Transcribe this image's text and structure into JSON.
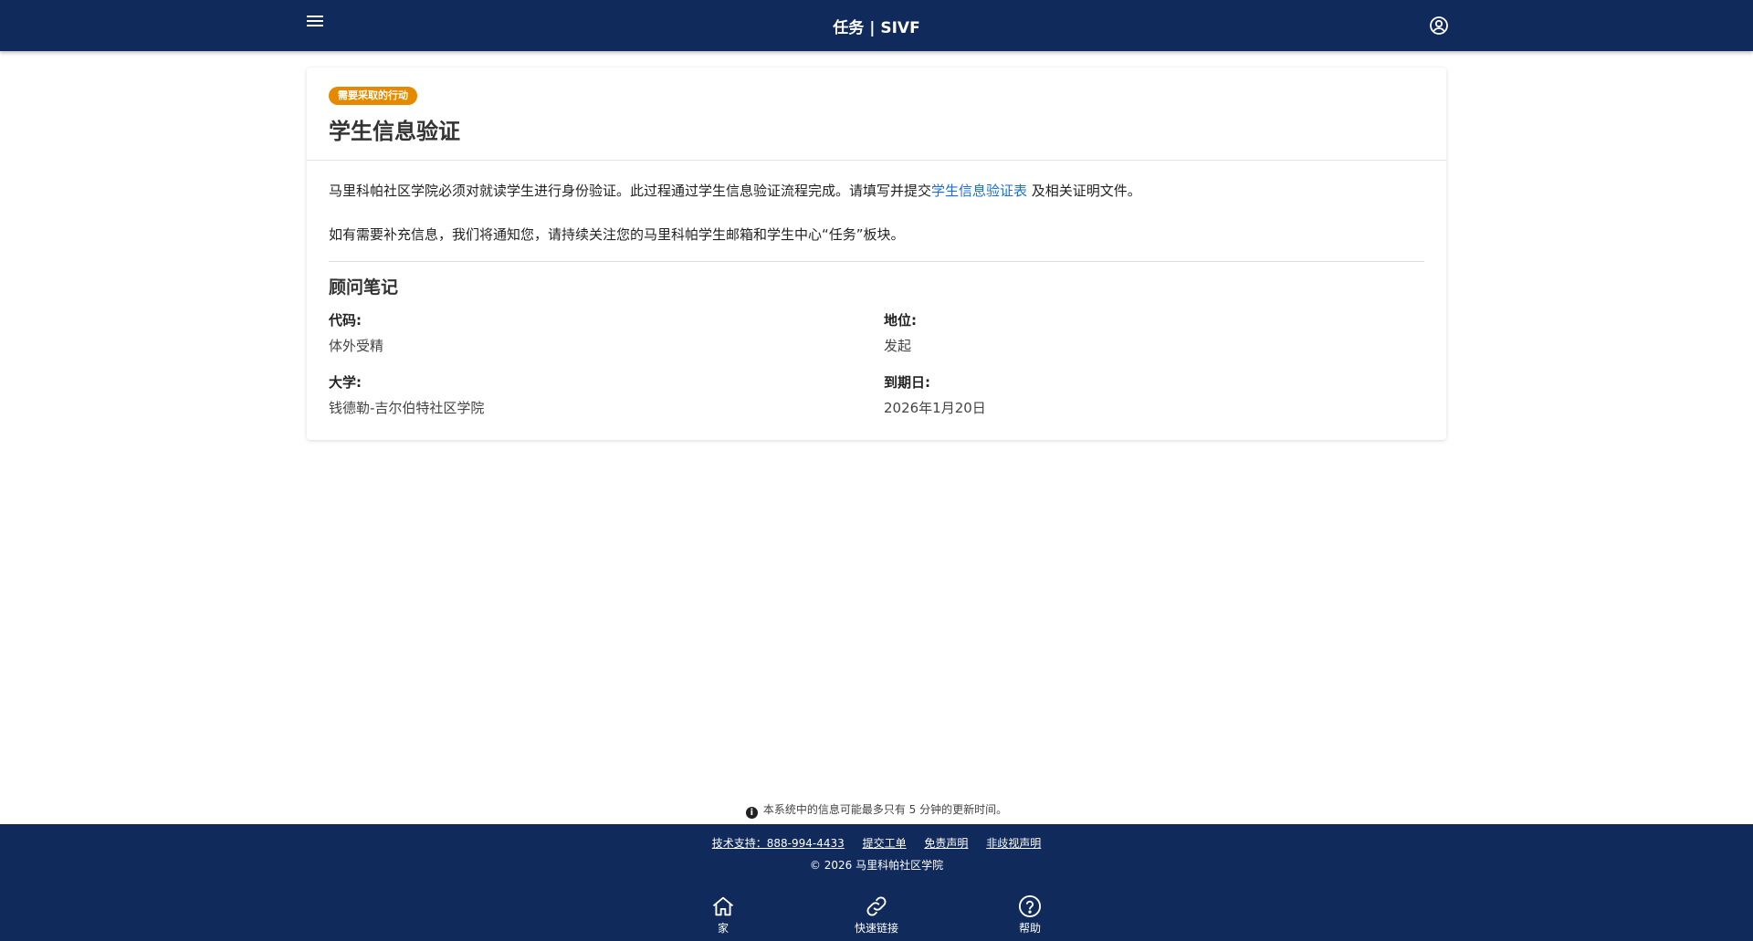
{
  "header": {
    "title": "任务 | SIVF"
  },
  "card": {
    "badge": "需要采取的行动",
    "title": "学生信息验证",
    "para1_prefix": "马里科帕社区学院必须对就读学生进行身份验证。此过程通过学生信息验证流程完成。请填写并提交",
    "para1_link": "学生信息验证表",
    "para1_suffix": " 及相关证明文件。",
    "para2": "如有需要补充信息，我们将通知您，请持续关注您的马里科帕学生邮箱和学生中心“任务”板块。",
    "section_title": "顾问笔记",
    "fields": {
      "code_label": "代码:",
      "code_value": "体外受精",
      "status_label": "地位:",
      "status_value": "发起",
      "college_label": "大学:",
      "college_value": "钱德勒-吉尔伯特社区学院",
      "due_label": "到期日:",
      "due_value": "2026年1月20日"
    }
  },
  "notice": "本系统中的信息可能最多只有 5 分钟的更新时间。",
  "footer": {
    "links": {
      "support": "技术支持：888-994-4433",
      "ticket": "提交工单",
      "disclaimer": "免责声明",
      "nondiscrimination": "非歧视声明"
    },
    "copyright": "© 2026 马里科帕社区学院",
    "nav": {
      "home": "家",
      "quick_links": "快速链接",
      "help": "帮助"
    }
  },
  "colors": {
    "navy": "#102a5c",
    "badge": "#e58a00",
    "link": "#1a6fd0"
  }
}
